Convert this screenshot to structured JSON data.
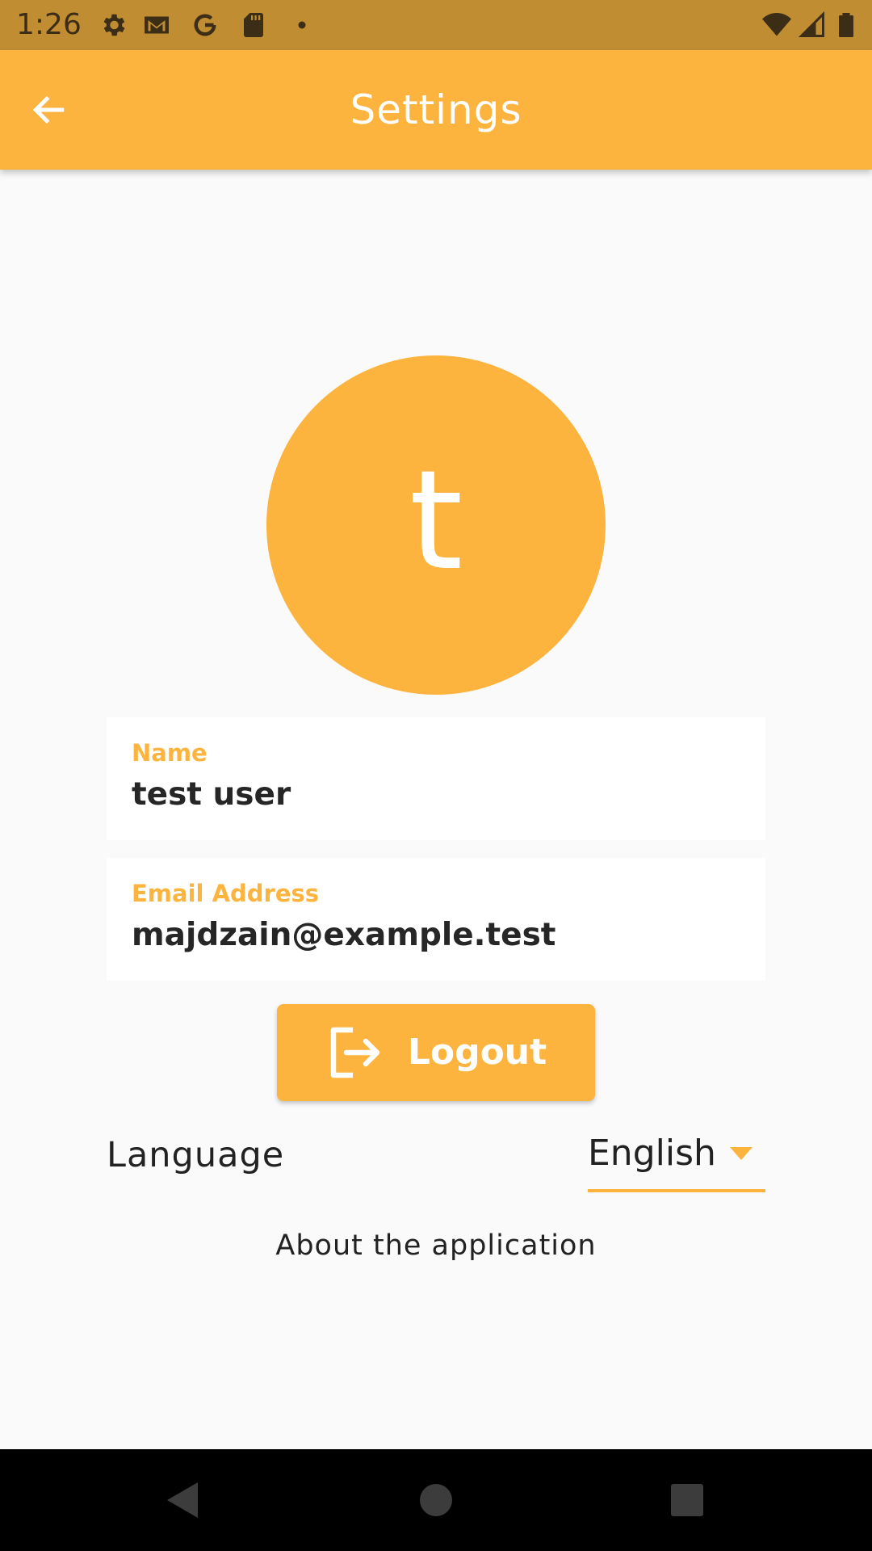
{
  "status_bar": {
    "time": "1:26",
    "left_icons": [
      "settings-gear-icon",
      "gmail-icon",
      "google-icon",
      "sd-card-icon",
      "notification-dot-icon"
    ],
    "right_icons": [
      "wifi-icon",
      "signal-icon",
      "battery-icon"
    ]
  },
  "app_bar": {
    "title": "Settings",
    "back_icon": "arrow-back-icon"
  },
  "profile": {
    "avatar_letter": "t"
  },
  "fields": {
    "name_label": "Name",
    "name_value": "test user",
    "email_label": "Email Address",
    "email_value": "majdzain@example.test"
  },
  "logout": {
    "label": "Logout",
    "icon": "logout-icon"
  },
  "language": {
    "label": "Language",
    "selected": "English"
  },
  "about": {
    "label": "About the application"
  },
  "nav_bar": {
    "buttons": [
      "back-triangle-icon",
      "home-circle-icon",
      "recents-square-icon"
    ]
  },
  "colors": {
    "accent": "#fdb43e",
    "status_bar": "#c08d33",
    "background": "#fafafa",
    "text": "#222222"
  }
}
